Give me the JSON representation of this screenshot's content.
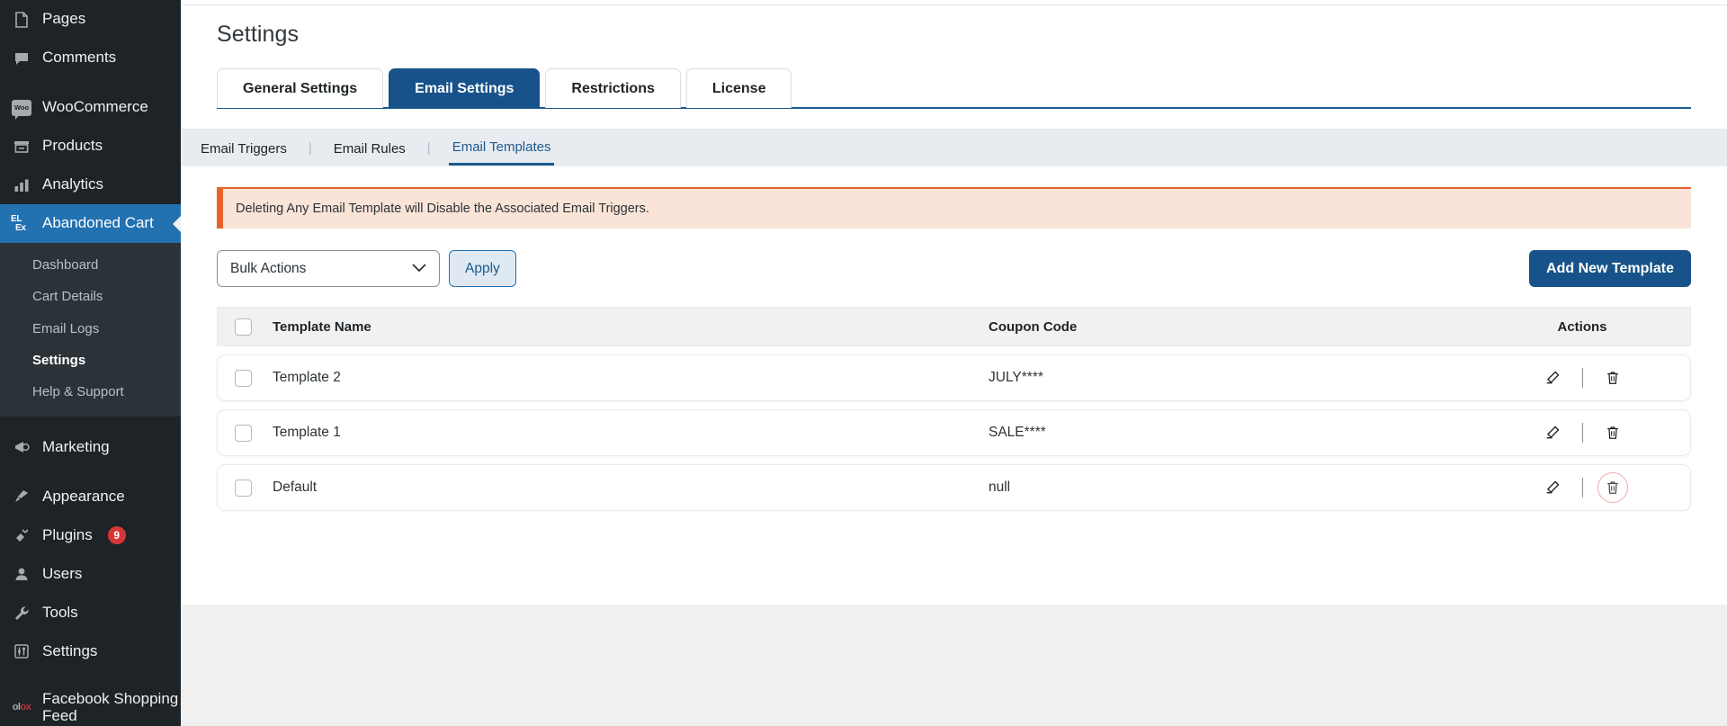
{
  "sidebar": {
    "items": [
      {
        "label": "Pages",
        "icon": "pages-icon"
      },
      {
        "label": "Comments",
        "icon": "comments-icon"
      },
      {
        "label": "WooCommerce",
        "icon": "woocommerce-icon"
      },
      {
        "label": "Products",
        "icon": "products-icon"
      },
      {
        "label": "Analytics",
        "icon": "analytics-icon"
      },
      {
        "label": "Abandoned Cart",
        "icon": "elex-icon"
      },
      {
        "label": "Marketing",
        "icon": "marketing-icon"
      },
      {
        "label": "Appearance",
        "icon": "appearance-icon"
      },
      {
        "label": "Plugins",
        "icon": "plugins-icon",
        "badge": "9"
      },
      {
        "label": "Users",
        "icon": "users-icon"
      },
      {
        "label": "Tools",
        "icon": "tools-icon"
      },
      {
        "label": "Settings",
        "icon": "settings-icon"
      },
      {
        "label": "Facebook Shopping Feed",
        "icon": "facebook-shopping-feed-icon"
      }
    ],
    "submenu": [
      {
        "label": "Dashboard"
      },
      {
        "label": "Cart Details"
      },
      {
        "label": "Email Logs"
      },
      {
        "label": "Settings"
      },
      {
        "label": "Help & Support"
      }
    ],
    "woo_logo_text": "Woo",
    "elex_logo_line1": "EL",
    "elex_logo_line2": "Ex",
    "fb_logo_a": "ol",
    "fb_logo_b": "ox"
  },
  "page": {
    "title": "Settings"
  },
  "tabs": [
    {
      "label": "General Settings"
    },
    {
      "label": "Email Settings"
    },
    {
      "label": "Restrictions"
    },
    {
      "label": "License"
    }
  ],
  "subtabs": [
    {
      "label": "Email Triggers"
    },
    {
      "label": "Email Rules"
    },
    {
      "label": "Email Templates"
    }
  ],
  "subtab_separator": "|",
  "notice": {
    "text": "Deleting Any Email Template will Disable the Associated Email Triggers."
  },
  "toolbar": {
    "bulk_actions_value": "Bulk Actions",
    "bulk_actions_options": [
      "Bulk Actions"
    ],
    "apply_label": "Apply",
    "add_new_label": "Add New Template"
  },
  "table": {
    "headers": {
      "template_name": "Template Name",
      "coupon_code": "Coupon Code",
      "actions": "Actions"
    },
    "rows": [
      {
        "name": "Template 2",
        "coupon": "JULY****",
        "delete_focused": false
      },
      {
        "name": "Template 1",
        "coupon": "SALE****",
        "delete_focused": false
      },
      {
        "name": "Default",
        "coupon": "null",
        "delete_focused": true
      }
    ]
  },
  "colors": {
    "sidebar_bg": "#1d2327",
    "sidebar_submenu_bg": "#2c3338",
    "accent_blue": "#2271b1",
    "tab_active_blue": "#17538a",
    "notice_bg": "#fae4d7",
    "notice_border": "#e8632a",
    "badge_red": "#d63638",
    "focus_ring_pink": "#f1a8ad"
  }
}
